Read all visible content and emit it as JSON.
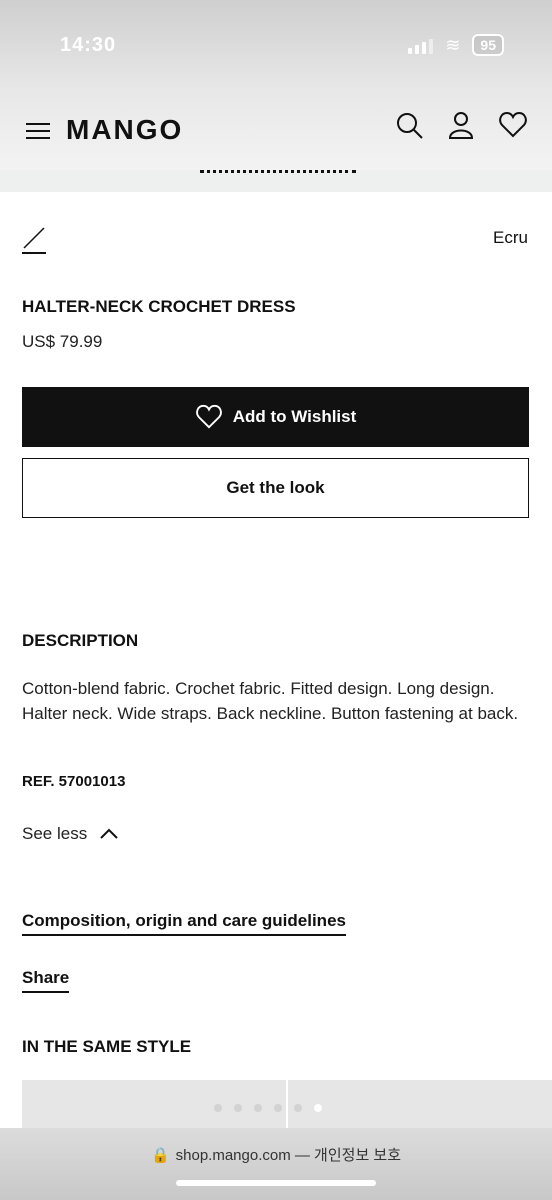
{
  "status": {
    "time": "14:30",
    "battery": "95"
  },
  "header": {
    "logo": "MANGO"
  },
  "product": {
    "color": "Ecru",
    "title": "HALTER-NECK CROCHET DRESS",
    "price": "US$ 79.99"
  },
  "actions": {
    "wishlist_label": "Add to Wishlist",
    "look_label": "Get the look"
  },
  "description": {
    "title": "DESCRIPTION",
    "text": "Cotton-blend fabric. Crochet fabric. Fitted design. Long design. Halter neck. Wide straps. Back neckline. Button fastening at back.",
    "ref": "REF. 57001013",
    "see_less": "See less"
  },
  "links": {
    "composition": "Composition, origin and care guidelines",
    "share": "Share"
  },
  "same_style": {
    "title": "IN THE SAME STYLE"
  },
  "browser": {
    "url": "shop.mango.com",
    "privacy": "— 개인정보 보호"
  },
  "icons": [
    "menu-icon",
    "search-icon",
    "account-icon",
    "heart-icon",
    "chevron-up-icon",
    "lock-icon"
  ]
}
